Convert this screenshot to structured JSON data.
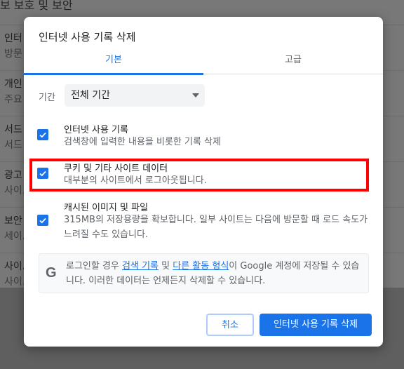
{
  "background": {
    "title": "보 보호 및 보안",
    "rows": [
      [
        "인터",
        "방문"
      ],
      [
        "개인",
        "주요"
      ],
      [
        "서드",
        "서드"
      ],
      [
        "광고",
        "사이.."
      ],
      [
        "보안",
        "세이.."
      ],
      [
        "사이..",
        "사이.."
      ]
    ]
  },
  "dialog": {
    "title": "인터넷 사용 기록 삭제",
    "tabs": [
      {
        "label": "기본",
        "active": true
      },
      {
        "label": "고급",
        "active": false
      }
    ],
    "period": {
      "label": "기간",
      "value": "전체 기간"
    },
    "items": [
      {
        "title": "인터넷 사용 기록",
        "desc": "검색창에 입력한 내용을 비롯한 기록 삭제",
        "checked": true
      },
      {
        "title": "쿠키 및 기타 사이트 데이터",
        "desc": "대부분의 사이트에서 로그아웃됩니다.",
        "checked": true,
        "highlighted": true
      },
      {
        "title": "캐시된 이미지 및 파일",
        "desc": "315MB의 저장용량을 확보합니다. 일부 사이트는 다음에 방문할 때 로드 속도가 느려질 수도 있습니다.",
        "checked": true
      }
    ],
    "info": {
      "icon": "google-g-icon",
      "text_before": "로그인할 경우 ",
      "link1": "검색 기록",
      "text_mid": " 및 ",
      "link2": "다른 활동 형식",
      "text_after": "이 Google 계정에 저장될 수 있습니다. 이러한 데이터는 언제든지 삭제할 수 있습니다."
    },
    "cancel_label": "취소",
    "confirm_label": "인터넷 사용 기록 삭제"
  },
  "colors": {
    "accent": "#1a73e8",
    "highlight": "#ff0000"
  }
}
